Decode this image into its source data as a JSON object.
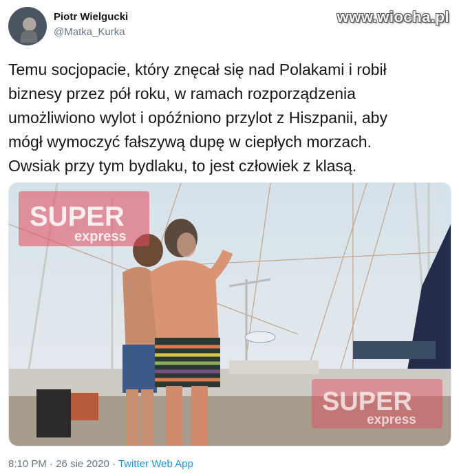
{
  "author": {
    "display_name": "Piotr Wielgucki",
    "handle": "@Matka_Kurka"
  },
  "site_watermark": "www.wiocha.pl",
  "tweet": {
    "lines": [
      "Temu socjopacie, który znęcał się nad Polakami i robił",
      "biznesy przez pół roku, w ramach rozporządzenia",
      "umożliwiono wylot i opóźniono przylot z Hiszpanii, aby",
      "mógł wymoczyć fałszywą dupę w ciepłych morzach.",
      "Owsiak przy tym bydlaku, to jest człowiek z klasą."
    ]
  },
  "photo": {
    "watermark_super": "SUPER",
    "watermark_express": "express"
  },
  "meta": {
    "time": "8:10 PM",
    "separator": "·",
    "date": "26 sie 2020",
    "app": "Twitter Web App"
  },
  "colors": {
    "link": "#1b95e0",
    "secondary_text": "#657786",
    "primary_text": "#14171a"
  }
}
